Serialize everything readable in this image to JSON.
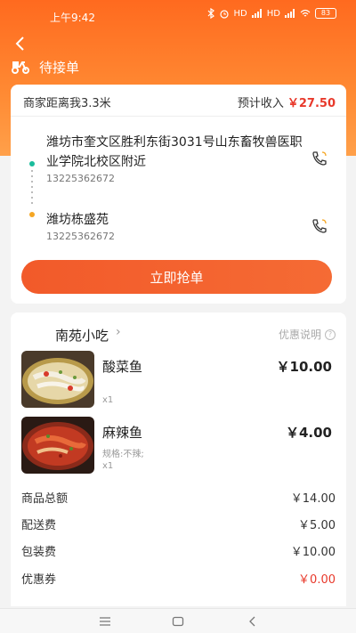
{
  "status_bar": {
    "time": "上午9:42",
    "battery": "83",
    "signal1": "HD",
    "signal2": "HD"
  },
  "header": {
    "title": "待接单"
  },
  "order": {
    "distance_label": "商家距离我3.3米",
    "income_label": "预计收入",
    "income_value": "￥27.50",
    "pickup": {
      "address": "潍坊市奎文区胜利东街3031号山东畜牧兽医职业学院北校区附近",
      "phone": "13225362672"
    },
    "dropoff": {
      "address": "潍坊栋盛苑",
      "phone": "13225362672"
    },
    "grab_button": "立即抢单"
  },
  "shop": {
    "name": "南苑小吃",
    "chevron": "›",
    "discount_note": "优惠说明",
    "discount_icon": "?"
  },
  "items": [
    {
      "name": "酸菜鱼",
      "price": "￥10.00",
      "spec": "",
      "qty": "x1"
    },
    {
      "name": "麻辣鱼",
      "price": "￥4.00",
      "spec": "规格:不辣;",
      "qty": "x1"
    }
  ],
  "fees": [
    {
      "label": "商品总额",
      "value": "￥14.00",
      "highlight": false
    },
    {
      "label": "配送费",
      "value": "￥5.00",
      "highlight": false
    },
    {
      "label": "包装费",
      "value": "￥10.00",
      "highlight": false
    },
    {
      "label": "优惠券",
      "value": "￥0.00",
      "highlight": true
    }
  ],
  "colors": {
    "accent": "#ff6a1f",
    "price_red": "#e8392b",
    "pickup_dot": "#1abc9c",
    "dropoff_dot": "#f5a623"
  },
  "icons": [
    "back-arrow-icon",
    "scooter-icon",
    "phone-icon",
    "info-icon",
    "menu-icon",
    "home-icon",
    "nav-back-icon"
  ]
}
